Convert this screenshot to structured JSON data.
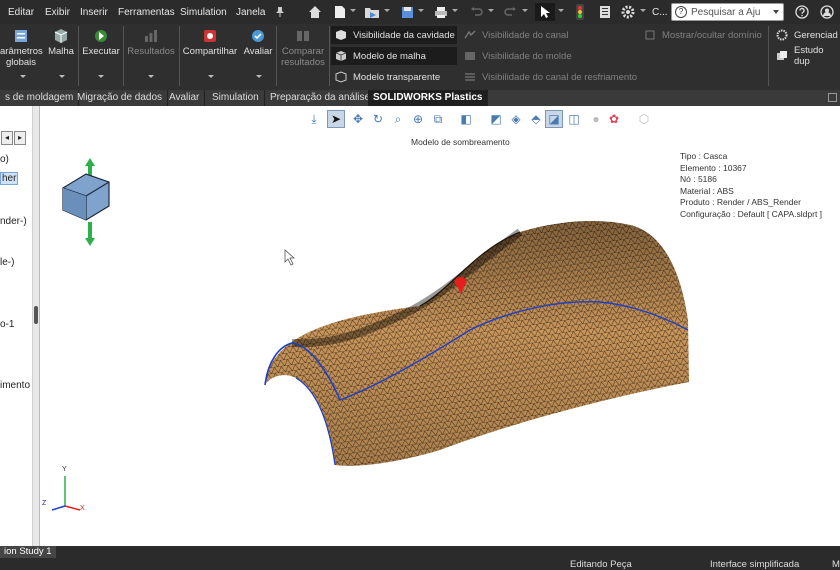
{
  "menubar": {
    "items": [
      "Editar",
      "Exibir",
      "Inserir",
      "Ferramentas",
      "Simulation",
      "Janela"
    ],
    "truncated_label": "C...",
    "search_placeholder": "Pesquisar a Aju"
  },
  "ribbon": {
    "parametros_label": "arâmetros",
    "globais_label": "globais",
    "malha_label": "Malha",
    "executar_label": "Executar",
    "resultados_label": "Resultados",
    "compartilhar_label": "Compartilhar",
    "avaliar_label": "Avaliar",
    "comparar_label": "Comparar",
    "comparar_label2": "resultados",
    "vis_cavidade": "Visibilidade da cavidade",
    "modelo_malha": "Modelo de malha",
    "modelo_transparente": "Modelo transparente",
    "vis_canal": "Visibilidade do canal",
    "vis_molde": "Visibilidade do molde",
    "vis_canal_resfriamento": "Visibilidade do canal de resfriamento",
    "mostrar_ocultar": "Mostrar/ocultar domínio",
    "gerenciador": "Gerenciad",
    "estudo": "Estudo dup"
  },
  "tabs": [
    "s de moldagem",
    "Migração de dados",
    "Avaliar",
    "Simulation",
    "Preparação da análise",
    "SOLIDWORKS Plastics"
  ],
  "left_panel": {
    "items": [
      "o)",
      "her",
      "nder-)",
      "le-)",
      "o-1",
      "imento"
    ]
  },
  "viewport": {
    "title": "Modelo de sombreamento",
    "info": [
      "Tipo : Casca",
      "Elemento : 10367",
      "Nó : 5186",
      "Material : ABS",
      "Produto : Render / ABS_Render",
      "Configuração : Default [ CAPA.sldprt ]"
    ],
    "triad": {
      "y": "Y",
      "x": "X",
      "z": "Z"
    }
  },
  "status": {
    "study_tab": "ion Study 1",
    "editing": "Editando Peça",
    "interface": "Interface simplificada",
    "extra": "M"
  },
  "colors": {
    "mesh_fill": "#c8955a",
    "mesh_edge": "#1a1a1a",
    "accent_blue": "#1e3fc8",
    "gate_red": "#e61e1e"
  }
}
